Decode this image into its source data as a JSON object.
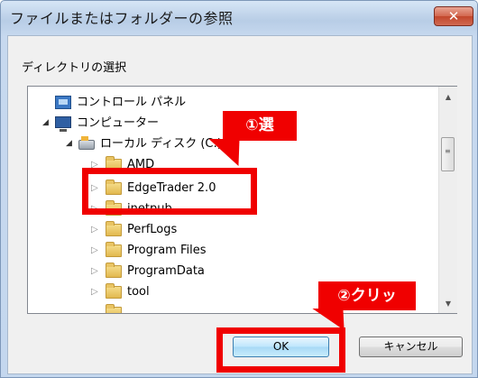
{
  "window": {
    "title": "ファイルまたはフォルダーの参照",
    "close_glyph": "✕"
  },
  "description": "ディレクトリの選択",
  "tree": {
    "items": [
      {
        "label": "コントロール パネル",
        "icon": "control-panel-icon",
        "expander": "none"
      },
      {
        "label": "コンピューター",
        "icon": "computer-icon",
        "expander": "expanded"
      },
      {
        "label": "ローカル ディスク (C:)",
        "icon": "local-disk-icon",
        "expander": "expanded"
      },
      {
        "label": "AMD",
        "icon": "folder-icon",
        "expander": "collapsed"
      },
      {
        "label": "EdgeTrader 2.0",
        "icon": "folder-icon",
        "expander": "collapsed",
        "selected": true
      },
      {
        "label": "inetpub",
        "icon": "folder-icon",
        "expander": "collapsed"
      },
      {
        "label": "PerfLogs",
        "icon": "folder-icon",
        "expander": "collapsed"
      },
      {
        "label": "Program Files",
        "icon": "folder-icon",
        "expander": "collapsed"
      },
      {
        "label": "ProgramData",
        "icon": "folder-icon",
        "expander": "collapsed"
      },
      {
        "label": "tool",
        "icon": "folder-icon",
        "expander": "collapsed"
      }
    ],
    "expander_collapsed_glyph": "▷",
    "expander_expanded_glyph": "◢"
  },
  "scrollbar": {
    "up_glyph": "▲",
    "down_glyph": "▼",
    "grip_glyph": "≡"
  },
  "buttons": {
    "ok": "OK",
    "cancel": "キャンセル"
  },
  "annotations": {
    "step1": "①選",
    "step2": "②クリッ",
    "color": "#f00000"
  }
}
